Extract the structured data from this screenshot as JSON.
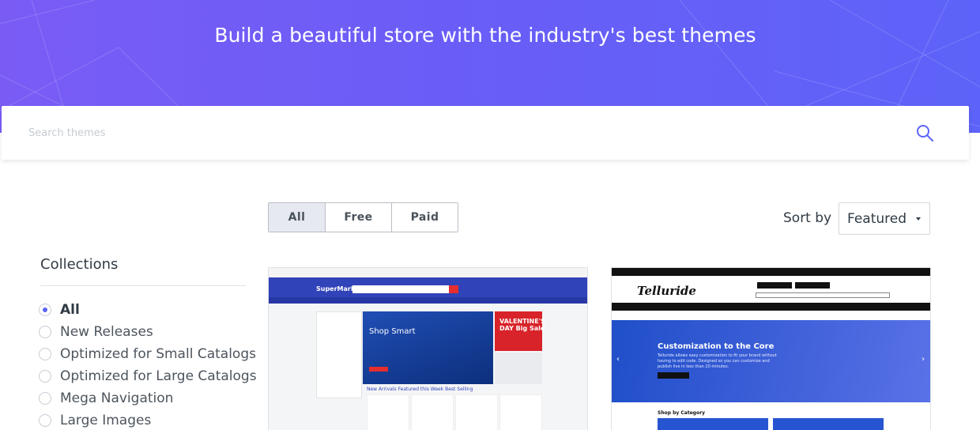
{
  "hero": {
    "title": "Build a beautiful store with the industry's best themes"
  },
  "search": {
    "placeholder": "Search themes"
  },
  "price_filter": {
    "tabs": [
      {
        "label": "All",
        "active": true
      },
      {
        "label": "Free",
        "active": false
      },
      {
        "label": "Paid",
        "active": false
      }
    ]
  },
  "sort": {
    "label": "Sort by",
    "selected": "Featured"
  },
  "collections": {
    "title": "Collections",
    "items": [
      {
        "label": "All",
        "selected": true
      },
      {
        "label": "New Releases",
        "selected": false
      },
      {
        "label": "Optimized for Small Catalogs",
        "selected": false
      },
      {
        "label": "Optimized for Large Catalogs",
        "selected": false
      },
      {
        "label": "Mega Navigation",
        "selected": false
      },
      {
        "label": "Large Images",
        "selected": false
      }
    ]
  },
  "themes": [
    {
      "preview": {
        "logo": "SuperMarket",
        "hero_text": "Shop Smart",
        "promo_text": "VALENTINE'S DAY Big Sale",
        "tabs_text": "New Arrivals   Featured this Week   Best Selling"
      }
    },
    {
      "preview": {
        "logo": "Telluride",
        "hero_title": "Customization to the Core",
        "hero_text": "Telluride allows easy customization to fit your brand without having to edit code. Designed so you can customize and publish live in less than 20 minutes.",
        "section_title": "Shop by Category"
      }
    }
  ],
  "colors": {
    "hero_gradient_start": "#7a5cf5",
    "hero_gradient_end": "#5d63f8",
    "accent": "#5d63f8",
    "active_tab_bg": "#e6e9ef"
  }
}
